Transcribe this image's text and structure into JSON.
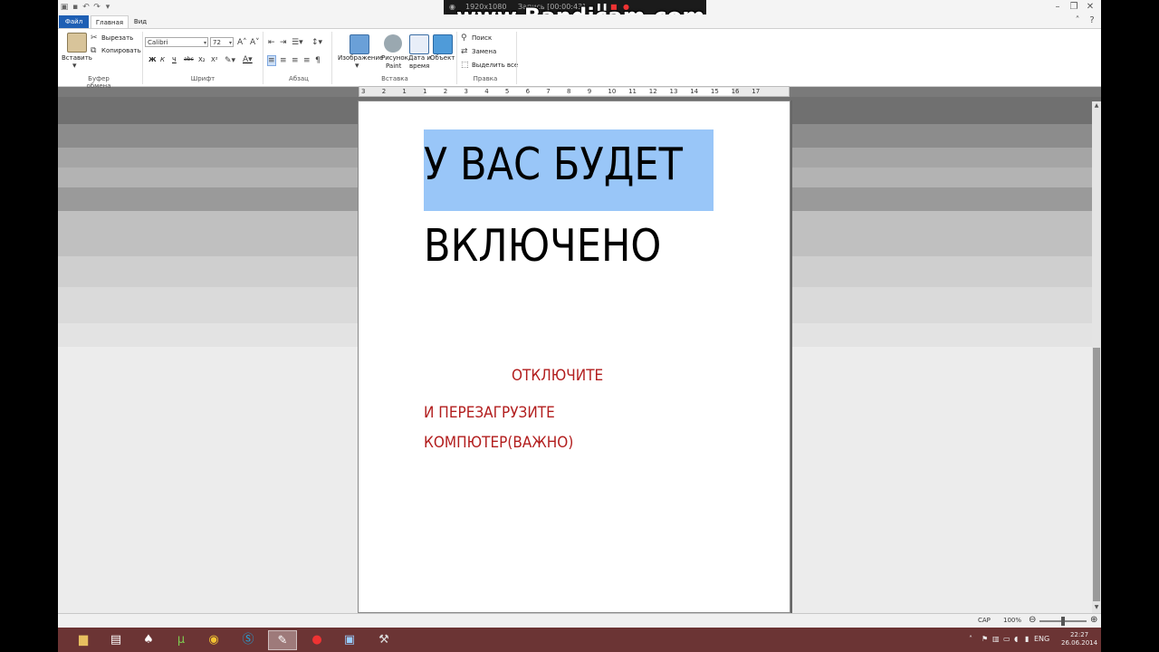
{
  "recorder": {
    "watermark": "www.Bandicam.com",
    "resolution": "1920x1080",
    "status": "Запись [00:00:43]"
  },
  "tabs": {
    "file": "Файл",
    "home": "Главная",
    "view": "Вид"
  },
  "ribbon": {
    "clipboard": {
      "paste": "Вставить",
      "cut": "Вырезать",
      "copy": "Копировать",
      "label": "Буфер обмена"
    },
    "font": {
      "family": "Calibri",
      "size": "72",
      "bold": "Ж",
      "italic": "К",
      "underline": "Ч",
      "strike": "abc",
      "subscript": "X₂",
      "superscript": "X²",
      "label": "Шрифт"
    },
    "paragraph": {
      "label": "Абзац"
    },
    "insert": {
      "image": "Изображение",
      "paint_1": "Рисунок",
      "paint_2": "Paint",
      "datetime_1": "Дата и",
      "datetime_2": "время",
      "object": "Объект",
      "label": "Вставка"
    },
    "editing": {
      "find": "Поиск",
      "replace": "Замена",
      "select_all": "Выделить все",
      "label": "Правка"
    }
  },
  "ruler": {
    "numbers": [
      "3",
      "2",
      "1",
      "1",
      "2",
      "3",
      "4",
      "5",
      "6",
      "7",
      "8",
      "9",
      "10",
      "11",
      "12",
      "13",
      "14",
      "15",
      "16",
      "17"
    ]
  },
  "document": {
    "line1": "У ВАС БУДЕТ",
    "line2": "ВКЛЮЧЕНО",
    "line3": "ОТКЛЮЧИТЕ",
    "line4": "И ПЕРЕЗАГРУЗИТЕ",
    "line5": "КОМПЮТЕР(ВАЖНО)"
  },
  "status": {
    "caps": "CAP",
    "zoom": "100%",
    "zoom_level": 0.5
  },
  "tray": {
    "language": "ENG",
    "time": "22:27",
    "date": "26.06.2014"
  },
  "colors": {
    "file_tab": "#1e5fb4",
    "selection": "#99c6f8",
    "red_text": "#b21d1d",
    "taskbar": "#6b3434"
  }
}
